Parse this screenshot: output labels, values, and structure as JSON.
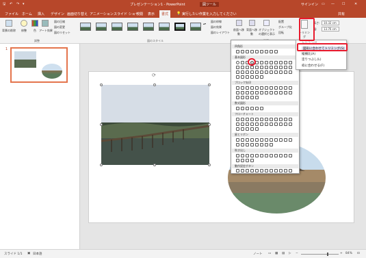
{
  "titlebar": {
    "doc_title": "プレゼンテーション1 - PowerPoint",
    "context_tab": "図ツール",
    "signin": "サインイン"
  },
  "tabs": [
    "ファイル",
    "ホーム",
    "挿入",
    "デザイン",
    "画面切り替え",
    "アニメーション",
    "スライド ショー",
    "校閲",
    "表示",
    "書式"
  ],
  "active_tab_index": 9,
  "tell_me": "実行したい作業を入力してください",
  "share": "共有",
  "ribbon": {
    "remove_bg": "背景の削除",
    "corrections": "修整",
    "color": "色",
    "art_effects": "アート効果",
    "compress": "図の圧縮",
    "change_pic": "図の変更",
    "reset_pic": "図のリセット",
    "group_adjust": "調整",
    "group_styles": "図のスタイル",
    "border": "図の枠線",
    "effects": "図の効果",
    "layout": "図のレイアウト",
    "bring_forward": "前面へ移動",
    "send_backward": "背面へ移動",
    "selection_pane": "オブジェクトの選択と表示",
    "align": "配置",
    "group_obj": "グループ化",
    "rotate": "回転",
    "group_arrange": "配置",
    "crop": "トリミング",
    "height_label": "高さ:",
    "height_value": "10.32 cm",
    "width_label": "幅:",
    "width_value": "13.76 cm"
  },
  "crop_menu": {
    "crop": "トリミング",
    "to_shape": "図形に合わせてトリミング(S)",
    "aspect": "縦横比(A)",
    "fill": "塗りつぶし(L)",
    "fit": "枠に合わせる(F)"
  },
  "shapes_menu": {
    "rect": "四角形",
    "basic": "基本図形",
    "block_arrows": "ブロック矢印",
    "equation": "数式図形",
    "flowchart": "フローチャート",
    "stars": "星とリボン",
    "callouts": "吹き出し",
    "action": "動作設定ボタン"
  },
  "thumb_number": "1",
  "status": {
    "slide": "スライド 1/1",
    "lang": "日本語",
    "notes": "ノート",
    "zoom": "84%"
  }
}
